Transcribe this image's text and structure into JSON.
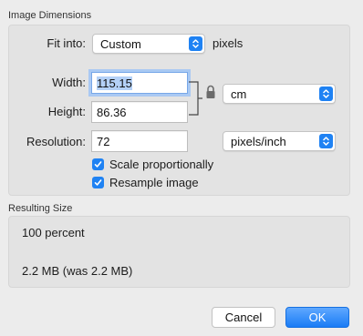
{
  "image_dimensions": {
    "title": "Image Dimensions",
    "fit_into": {
      "label": "Fit into:",
      "selected": "Custom",
      "unit_text": "pixels"
    },
    "width": {
      "label": "Width:",
      "value": "115.15"
    },
    "height": {
      "label": "Height:",
      "value": "86.36"
    },
    "size_unit": {
      "selected": "cm"
    },
    "resolution": {
      "label": "Resolution:",
      "value": "72",
      "unit_selected": "pixels/inch"
    },
    "scale_proportionally": {
      "label": "Scale proportionally",
      "checked": true
    },
    "resample_image": {
      "label": "Resample image",
      "checked": true
    }
  },
  "resulting_size": {
    "title": "Resulting Size",
    "percent_text": "100 percent",
    "size_text": "2.2 MB (was 2.2 MB)"
  },
  "buttons": {
    "cancel_label": "Cancel",
    "ok_label": "OK"
  },
  "colors": {
    "accent": "#1f82f3",
    "focus_ring": "#a9c9f3",
    "selection": "#b4d1f7",
    "window_bg": "#ececec"
  }
}
